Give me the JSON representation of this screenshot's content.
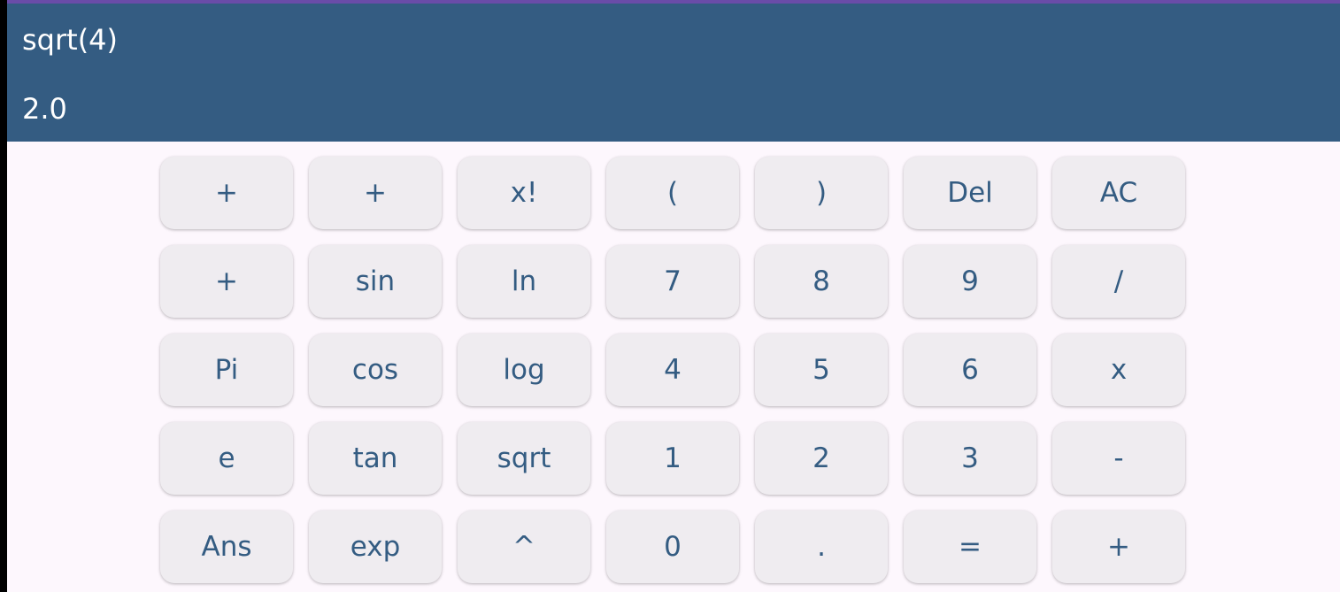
{
  "display": {
    "expression": "sqrt(4)",
    "result": "2.0"
  },
  "colors": {
    "display_bg": "#345c82",
    "accent_top": "#6a4ca8",
    "key_bg": "#efecf0",
    "key_text": "#345c82",
    "page_bg": "#fdf7fd"
  },
  "keypad": {
    "rows": [
      [
        {
          "name": "plus-button-r1c1",
          "label": "+"
        },
        {
          "name": "plus-button-r1c2",
          "label": "+"
        },
        {
          "name": "factorial-button",
          "label": "x!"
        },
        {
          "name": "open-paren-button",
          "label": "("
        },
        {
          "name": "close-paren-button",
          "label": ")"
        },
        {
          "name": "delete-button",
          "label": "Del"
        },
        {
          "name": "all-clear-button",
          "label": "AC"
        }
      ],
      [
        {
          "name": "plus-button-r2c1",
          "label": "+"
        },
        {
          "name": "sin-button",
          "label": "sin"
        },
        {
          "name": "ln-button",
          "label": "ln"
        },
        {
          "name": "digit-7-button",
          "label": "7"
        },
        {
          "name": "digit-8-button",
          "label": "8"
        },
        {
          "name": "digit-9-button",
          "label": "9"
        },
        {
          "name": "divide-button",
          "label": "/"
        }
      ],
      [
        {
          "name": "pi-button",
          "label": "Pi"
        },
        {
          "name": "cos-button",
          "label": "cos"
        },
        {
          "name": "log-button",
          "label": "log"
        },
        {
          "name": "digit-4-button",
          "label": "4"
        },
        {
          "name": "digit-5-button",
          "label": "5"
        },
        {
          "name": "digit-6-button",
          "label": "6"
        },
        {
          "name": "multiply-button",
          "label": "x"
        }
      ],
      [
        {
          "name": "e-button",
          "label": "e"
        },
        {
          "name": "tan-button",
          "label": "tan"
        },
        {
          "name": "sqrt-button",
          "label": "sqrt"
        },
        {
          "name": "digit-1-button",
          "label": "1"
        },
        {
          "name": "digit-2-button",
          "label": "2"
        },
        {
          "name": "digit-3-button",
          "label": "3"
        },
        {
          "name": "minus-button",
          "label": "-"
        }
      ],
      [
        {
          "name": "ans-button",
          "label": "Ans"
        },
        {
          "name": "exp-button",
          "label": "exp"
        },
        {
          "name": "power-button",
          "label": "^"
        },
        {
          "name": "digit-0-button",
          "label": "0"
        },
        {
          "name": "decimal-point-button",
          "label": "."
        },
        {
          "name": "equals-button",
          "label": "="
        },
        {
          "name": "plus-button",
          "label": "+"
        }
      ]
    ]
  }
}
